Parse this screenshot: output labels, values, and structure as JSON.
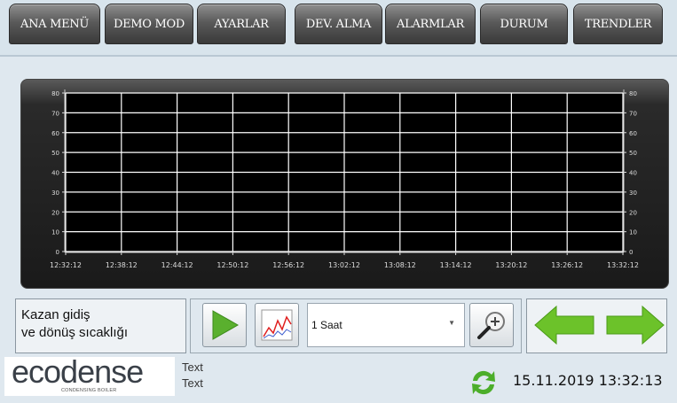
{
  "nav": {
    "items": [
      {
        "label": "ANA MENÜ"
      },
      {
        "label": "DEMO MOD"
      },
      {
        "label": "AYARLAR"
      },
      {
        "label": "DEV. ALMA"
      },
      {
        "label": "ALARMLAR"
      },
      {
        "label": "DURUM"
      },
      {
        "label": "TRENDLER"
      }
    ]
  },
  "chart_data": {
    "type": "line",
    "x": [
      "12:32:12",
      "12:38:12",
      "12:44:12",
      "12:50:12",
      "12:56:12",
      "13:02:12",
      "13:08:12",
      "13:14:12",
      "13:20:12",
      "13:26:12",
      "13:32:12"
    ],
    "y_ticks": [
      0,
      10,
      20,
      30,
      40,
      50,
      60,
      70,
      80
    ],
    "ylim": [
      0,
      80
    ],
    "series": [],
    "grid": true
  },
  "panel": {
    "description": "Kazan gidiş\nve dönüş sıcaklığı",
    "range_select_value": "1 Saat"
  },
  "footer": {
    "logo_main": "ecodense",
    "logo_sub": "CONDENSING BOILER",
    "text_line1": "Text",
    "text_line2": "Text",
    "datetime": "15.11.2019 13:32:13"
  },
  "colors": {
    "play": "#5ab02e",
    "arrows": "#6cc22a",
    "refresh": "#4cae2a",
    "grid": "#ffffff",
    "plot_bg": "#000000"
  }
}
